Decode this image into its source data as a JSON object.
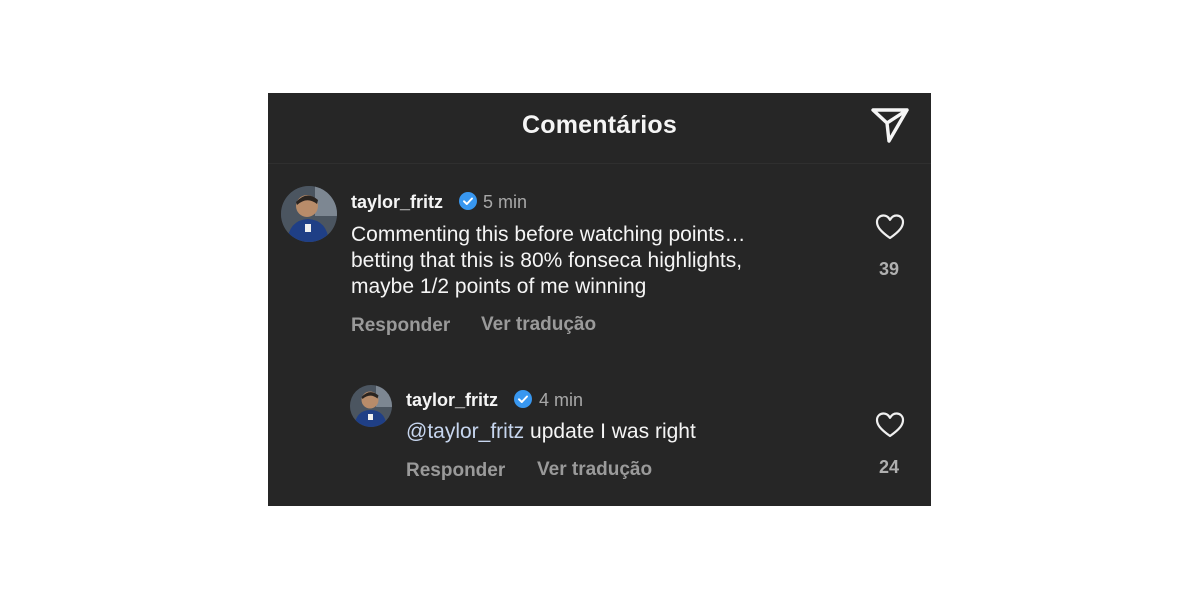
{
  "header": {
    "title": "Comentários",
    "share_icon": "send-icon"
  },
  "comments": [
    {
      "username": "taylor_fritz",
      "verified": true,
      "time": "5 min",
      "text": "Commenting this before watching points… betting that this is 80% fonseca highlights, maybe 1/2 points of me winning",
      "text_lines": [
        "Commenting this before watching points…",
        "betting that this is 80% fonseca highlights,",
        "maybe 1/2 points of me winning"
      ],
      "reply_label": "Responder",
      "translate_label": "Ver tradução",
      "likes": "39"
    },
    {
      "username": "taylor_fritz",
      "verified": true,
      "time": "4 min",
      "mention": "@taylor_fritz",
      "text": "update I was right",
      "reply_label": "Responder",
      "translate_label": "Ver tradução",
      "likes": "24"
    }
  ],
  "colors": {
    "background": "#262626",
    "text": "#f5f5f5",
    "secondary": "#a8a8a8",
    "verified": "#3897f0",
    "mention": "#c7d6ef"
  }
}
